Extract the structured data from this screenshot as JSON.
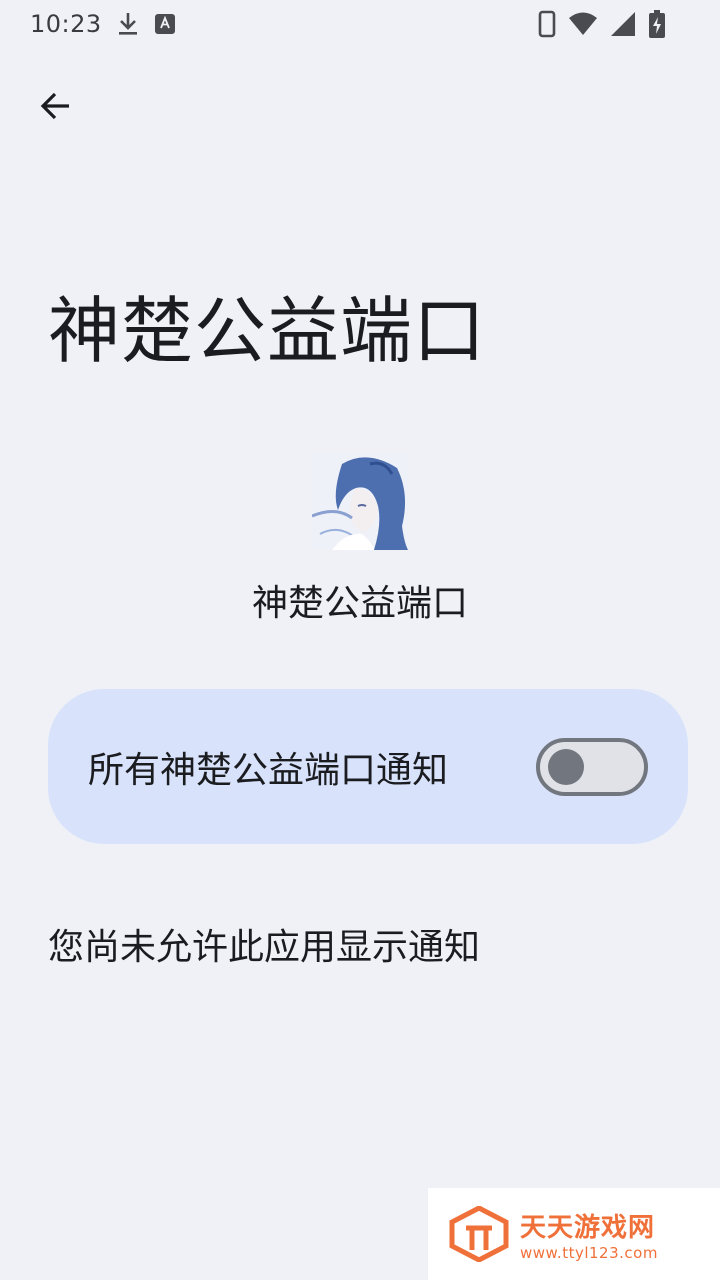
{
  "status_bar": {
    "time": "10:23",
    "icons": [
      "download-icon",
      "keyboard-a-icon",
      "phone-icon",
      "wifi-icon",
      "signal-icon",
      "battery-charging-icon"
    ]
  },
  "header": {
    "back_icon": "arrow-left-icon",
    "title": "神楚公益端口"
  },
  "app": {
    "icon": "app-icon-anime-girl",
    "name": "神楚公益端口"
  },
  "notification_setting": {
    "label": "所有神楚公益端口通知",
    "enabled": false
  },
  "message": "您尚未允许此应用显示通知",
  "watermark": {
    "title": "天天游戏网",
    "url": "www.ttyl123.com",
    "color": "#f0703a"
  },
  "colors": {
    "background": "#f0f1f7",
    "card": "#d8e3fb",
    "toggle_outline": "#72767e"
  }
}
